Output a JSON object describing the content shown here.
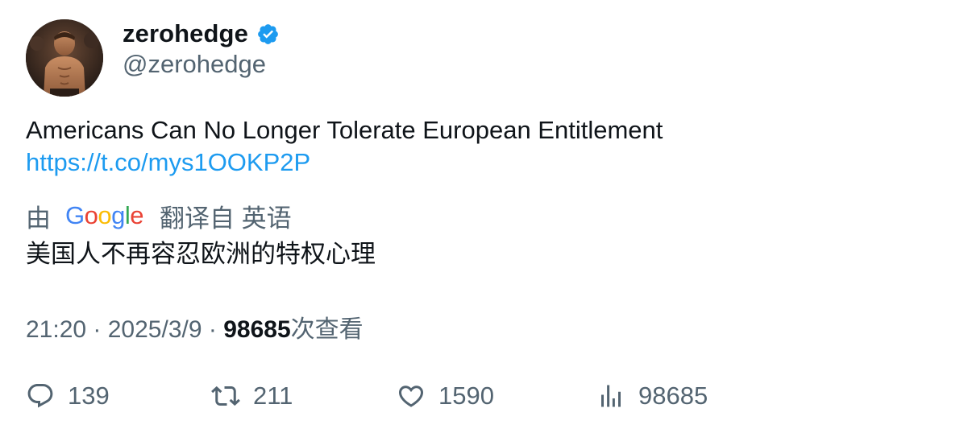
{
  "author": {
    "display_name": "zerohedge",
    "handle": "@zerohedge",
    "verified_icon": "verified-badge-icon",
    "accent_color": "#1d9bf0"
  },
  "tweet": {
    "text": "Americans Can No Longer Tolerate European Entitlement",
    "link": "https://t.co/mys1OOKP2P"
  },
  "translation": {
    "by_label": "由",
    "provider": "Google",
    "translated_from_label": "翻译自 英语",
    "text": "美国人不再容忍欧洲的特权心理"
  },
  "meta": {
    "time": "21:20",
    "separator": "·",
    "date": "2025/3/9",
    "views": "98685",
    "views_label": "次查看"
  },
  "actions": {
    "replies": "139",
    "retweets": "211",
    "likes": "1590",
    "views": "98685"
  },
  "icons": {
    "reply": "reply-icon",
    "retweet": "retweet-icon",
    "like": "heart-icon",
    "views": "views-bar-chart-icon"
  },
  "colors": {
    "text_primary": "#0f1419",
    "text_secondary": "#536471",
    "link": "#1d9bf0"
  }
}
